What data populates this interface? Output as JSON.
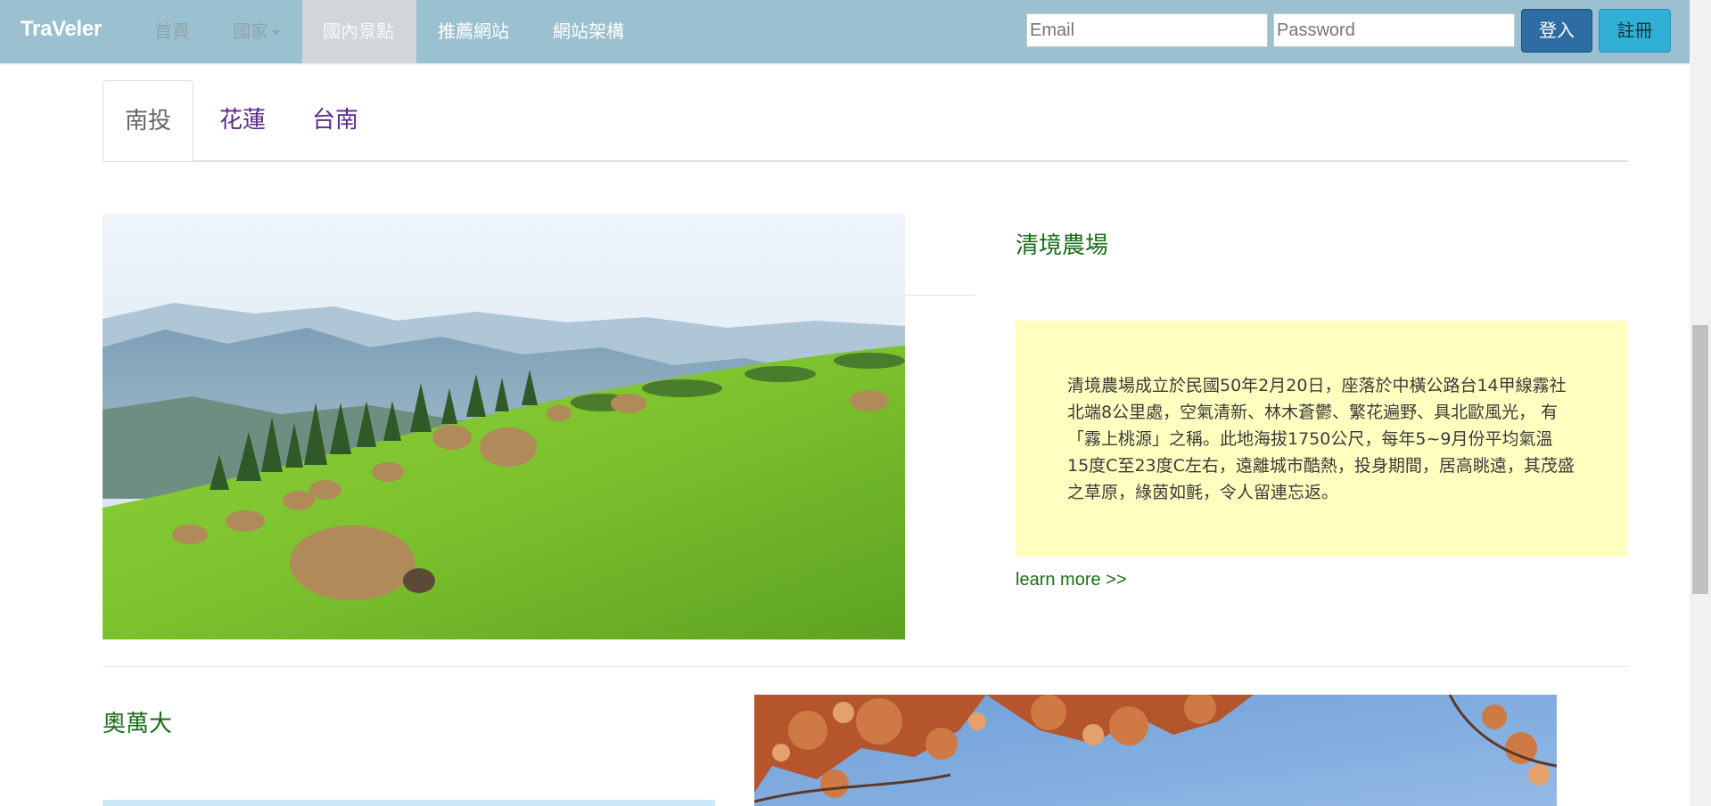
{
  "navbar": {
    "brand": "TraVeler",
    "items": [
      {
        "label": "首頁"
      },
      {
        "label": "國家"
      },
      {
        "label": "國內景點"
      },
      {
        "label": "推薦網站"
      },
      {
        "label": "網站架構"
      }
    ],
    "email_placeholder": "Email",
    "password_placeholder": "Password",
    "login_label": "登入",
    "register_label": "註冊"
  },
  "tabs": [
    {
      "label": "南投",
      "active": true
    },
    {
      "label": "花蓮",
      "active": false
    },
    {
      "label": "台南",
      "active": false
    }
  ],
  "spots": [
    {
      "title": "清境農場",
      "description": "清境農場成立於民國50年2月20日，座落於中橫公路台14甲線霧社 北端8公里處，空氣清新、林木蒼鬱、繁花遍野、具北歐風光， 有「霧上桃源」之稱。此地海拔1750公尺，每年5~9月份平均氣溫 15度C至23度C左右，遠離城市酷熱，投身期間，居高眺遠，其茂盛 之草原，綠茵如氈，令人留連忘返。",
      "link": "learn more >>",
      "box_color": "#ffffc0"
    },
    {
      "title": "奧萬大",
      "box_color": "#cde9f7"
    }
  ],
  "colors": {
    "navbar_bg": "#9bc0d0",
    "spot_title": "#1b6b1b",
    "tab_link": "#5b2a8f",
    "login_button": "#2e6da4",
    "register_button": "#31b0d5"
  }
}
